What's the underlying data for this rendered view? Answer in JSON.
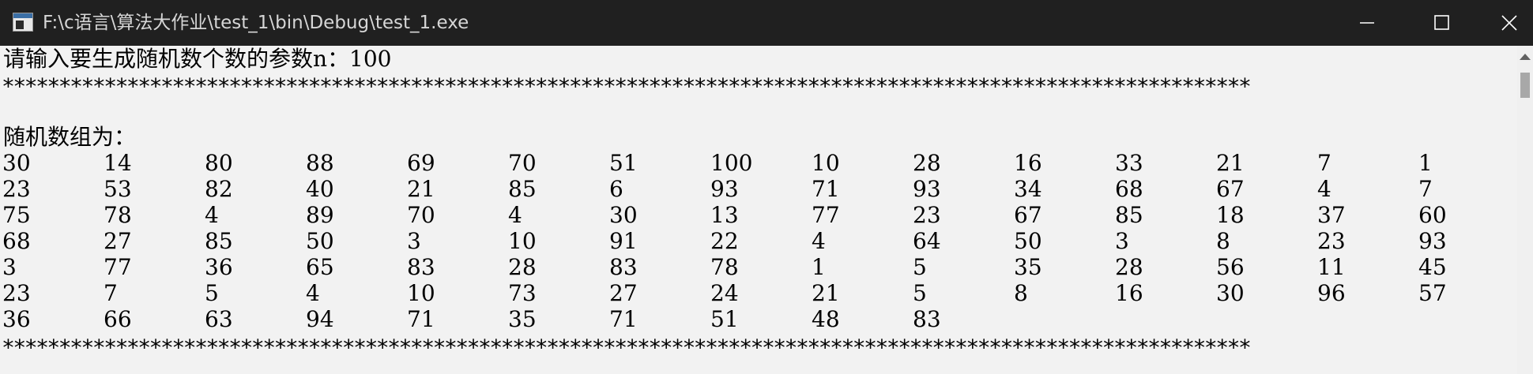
{
  "window": {
    "title": "F:\\c语言\\算法大作业\\test_1\\bin\\Debug\\test_1.exe",
    "minimize_label": "minimize",
    "maximize_label": "maximize",
    "close_label": "close"
  },
  "console": {
    "prompt": "请输入要生成随机数个数的参数n：100",
    "separator": "**************************************************************************************************************",
    "array_label": "随机数组为：",
    "rows": [
      [
        "30",
        "14",
        "80",
        "88",
        "69",
        "70",
        "51",
        "100",
        "10",
        "28",
        "16",
        "33",
        "21",
        "7",
        "1"
      ],
      [
        "23",
        "53",
        "82",
        "40",
        "21",
        "85",
        "6",
        "93",
        "71",
        "93",
        "34",
        "68",
        "67",
        "4",
        "7"
      ],
      [
        "75",
        "78",
        "4",
        "89",
        "70",
        "4",
        "30",
        "13",
        "77",
        "23",
        "67",
        "85",
        "18",
        "37",
        "60"
      ],
      [
        "68",
        "27",
        "85",
        "50",
        "3",
        "10",
        "91",
        "22",
        "4",
        "64",
        "50",
        "3",
        "8",
        "23",
        "93"
      ],
      [
        "3",
        "77",
        "36",
        "65",
        "83",
        "28",
        "83",
        "78",
        "1",
        "5",
        "35",
        "28",
        "56",
        "11",
        "45"
      ],
      [
        "23",
        "7",
        "5",
        "4",
        "10",
        "73",
        "27",
        "24",
        "21",
        "5",
        "8",
        "16",
        "30",
        "96",
        "57"
      ],
      [
        "36",
        "66",
        "63",
        "94",
        "71",
        "35",
        "71",
        "51",
        "48",
        "83"
      ]
    ]
  },
  "colors": {
    "titlebar": "#202020",
    "console_bg": "#f2f2f2",
    "text": "#000000"
  }
}
